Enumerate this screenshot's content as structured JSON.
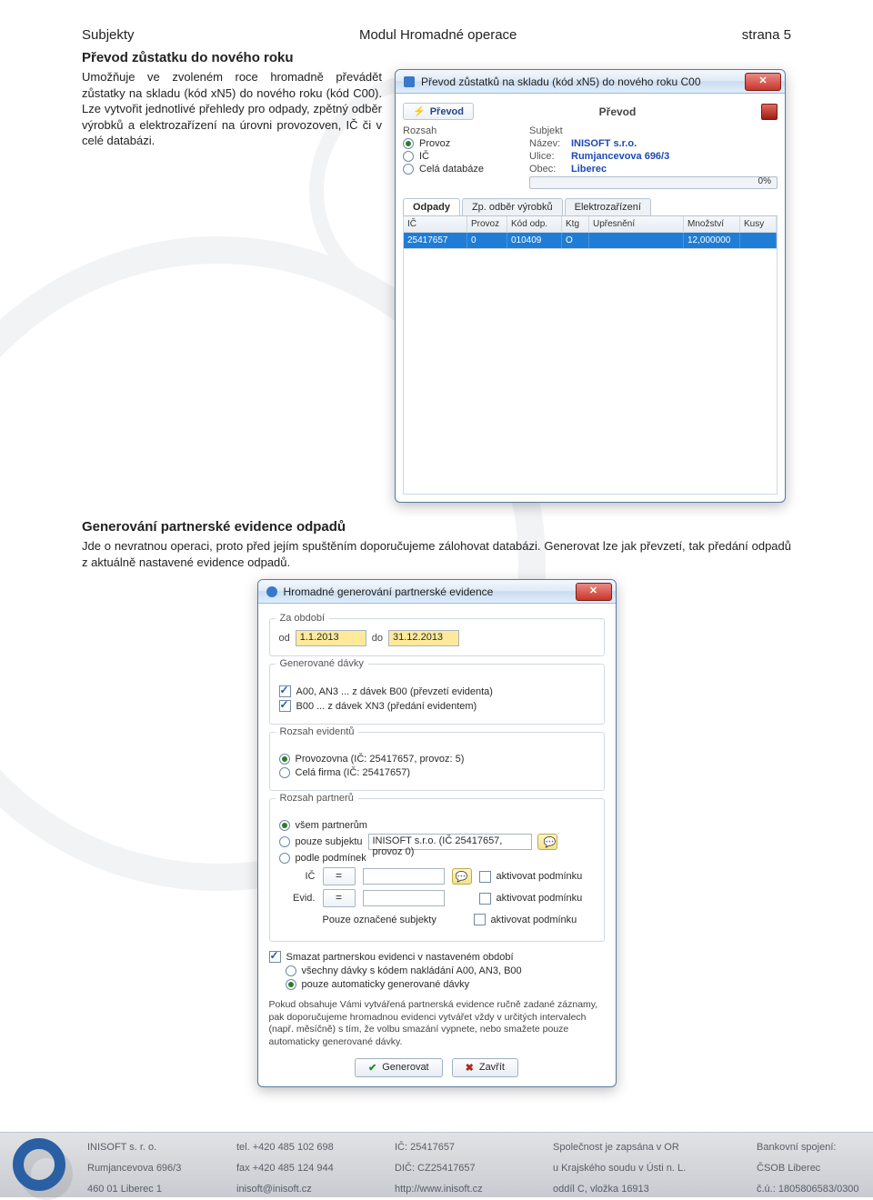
{
  "header": {
    "left": "Subjekty",
    "center": "Modul Hromadné operace",
    "right": "strana 5"
  },
  "section1": {
    "title": "Převod zůstatku do nového roku",
    "text": "Umožňuje ve zvoleném roce hromadně převádět zůstatky na skladu (kód xN5) do nového roku (kód C00). Lze vytvořit jednotlivé přehledy pro odpady, zpětný odběr výrobků a elektrozařízení na úrovni provozoven, IČ či v celé databázi."
  },
  "dlg1": {
    "title": "Převod zůstatků na skladu (kód xN5) do nového roku C00",
    "toolbar_label": "Převod",
    "toolbar_header": "Převod",
    "rozsah_label": "Rozsah",
    "subjekt_label": "Subjekt",
    "opt_provoz": "Provoz",
    "opt_ic": "IČ",
    "opt_db": "Celá databáze",
    "nazev_label": "Název:",
    "nazev_value": "INISOFT s.r.o.",
    "ulice_label": "Ulice:",
    "ulice_value": "Rumjancevova 696/3",
    "obec_label": "Obec:",
    "obec_value": "Liberec",
    "progress_text": "0%",
    "tab1": "Odpady",
    "tab2": "Zp. odběr výrobků",
    "tab3": "Elektrozařízení",
    "cols": {
      "c1": "IČ",
      "c2": "Provoz",
      "c3": "Kód odp.",
      "c4": "Ktg",
      "c5": "Upřesnění",
      "c6": "Množství",
      "c7": "Kusy"
    },
    "row": {
      "c1": "25417657",
      "c2": "0",
      "c3": "010409",
      "c4": "O",
      "c5": "",
      "c6": "12,000000",
      "c7": ""
    }
  },
  "section2": {
    "title": "Generování partnerské evidence odpadů",
    "p1": "Jde o nevratnou operaci, proto před jejím spuštěním doporučujeme zálohovat databázi. Generovat lze jak převzetí, tak předání odpadů z aktuálně nastavené evidence odpadů."
  },
  "dlg2": {
    "title": "Hromadné generování partnerské evidence",
    "za_obdobi_label": "Za období",
    "od_label": "od",
    "od_value": "1.1.2013",
    "do_label": "do",
    "do_value": "31.12.2013",
    "gen_davky_label": "Generované dávky",
    "g1": "A00, AN3 ... z dávek B00 (převzetí evidenta)",
    "g2": "B00 ... z dávek XN3 (předání evidentem)",
    "rozsah_evid_label": "Rozsah evidentů",
    "re1": "Provozovna (IČ: 25417657, provoz: 5)",
    "re2": "Celá firma (IČ: 25417657)",
    "rozsah_part_label": "Rozsah partnerů",
    "rp1": "všem partnerům",
    "rp2": "pouze subjektu",
    "rp2_input": "INISOFT s.r.o. (IČ 25417657, provoz 0)",
    "rp3": "podle podmínek",
    "ic_label": "IČ",
    "eq_symbol": "=",
    "evid_label": "Evid.",
    "akt_pod": "aktivovat podmínku",
    "ozn_subj": "Pouze označené subjekty",
    "smazat_check": "Smazat partnerskou evidenci v nastaveném období",
    "sm_opt1": "všechny dávky s kódem nakládání A00, AN3, B00",
    "sm_opt2": "pouze automaticky generované dávky",
    "note": "Pokud obsahuje Vámi vytvářená partnerská evidence ručně zadané záznamy, pak doporučujeme hromadnou evidenci vytvářet vždy v určitých intervalech (např. měsíčně) s tím, že volbu smazání vypnete, nebo smažete pouze automaticky generované dávky.",
    "btn_gen": "Generovat",
    "btn_close": "Zavřít"
  },
  "footer": {
    "col1": {
      "l1": "INISOFT s. r. o.",
      "l2": "Rumjancevova 696/3",
      "l3": "460 01  Liberec 1"
    },
    "col2": {
      "l1": "tel. +420 485 102 698",
      "l2": "fax +420 485 124 944",
      "l3": "inisoft@inisoft.cz"
    },
    "col3": {
      "l1": "IČ: 25417657",
      "l2": "DIČ: CZ25417657",
      "l3": "http://www.inisoft.cz"
    },
    "col4": {
      "l1": "Společnost je zapsána v OR",
      "l2": "u Krajského soudu v Ústi n. L.",
      "l3": "oddíl C, vložka 16913"
    },
    "col5": {
      "l1": "Bankovní spojení:",
      "l2": "ČSOB Liberec",
      "l3": "č.ú.: 1805806583/0300"
    }
  }
}
